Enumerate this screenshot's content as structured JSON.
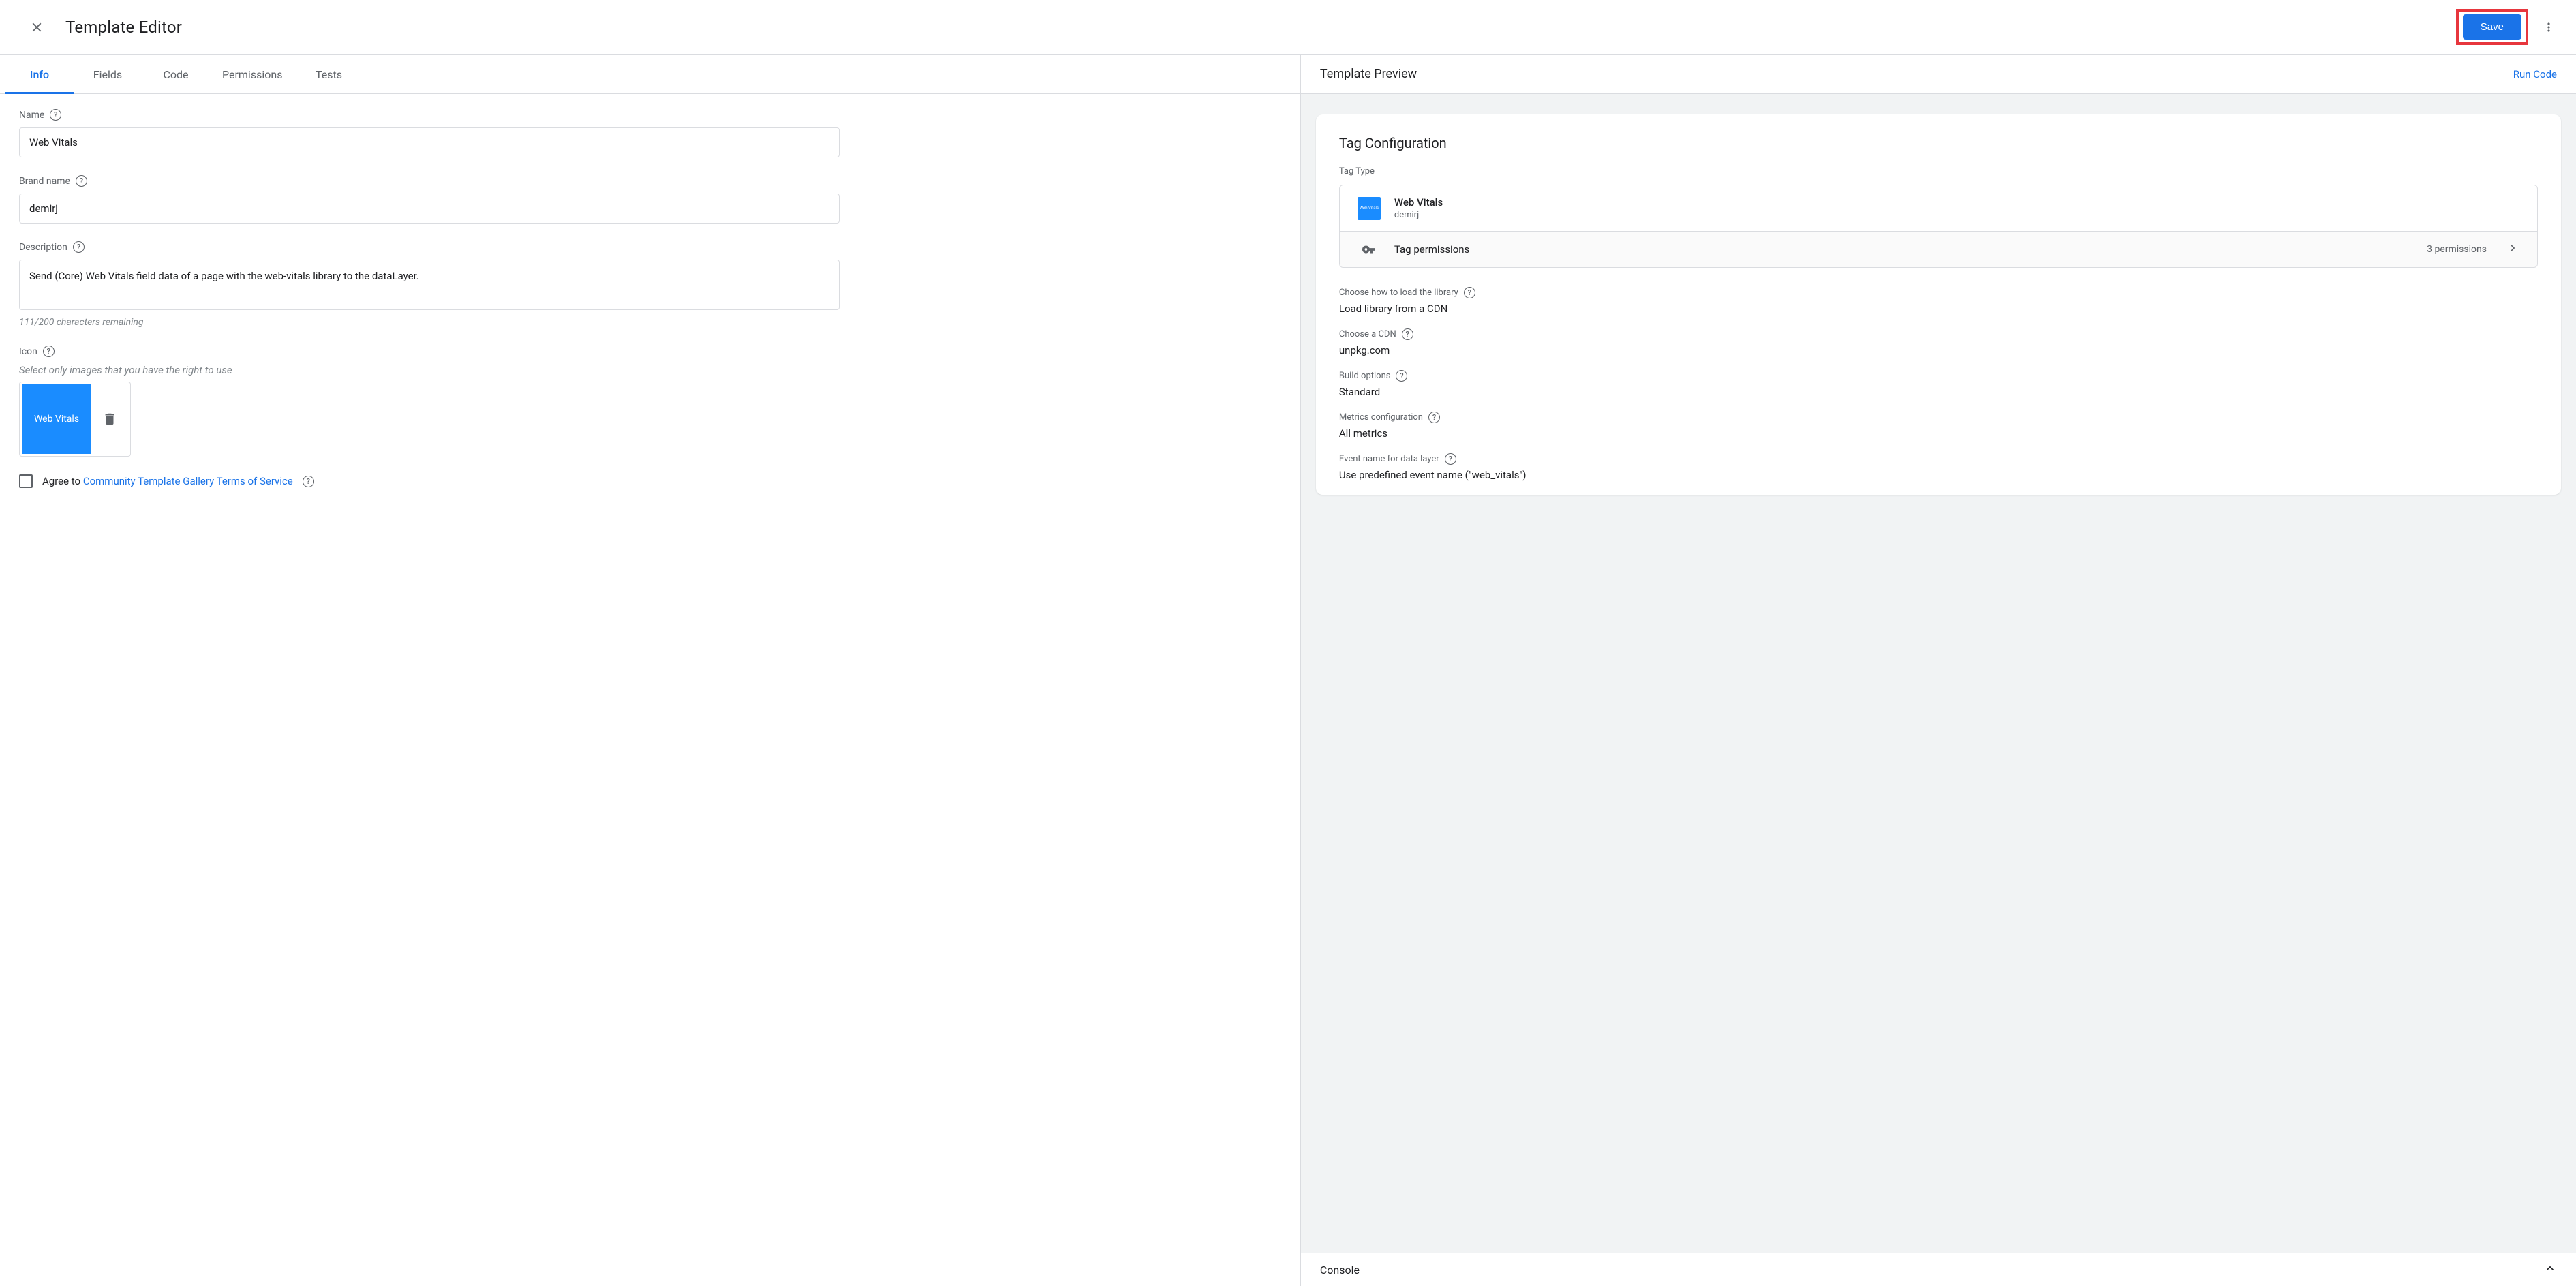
{
  "header": {
    "title": "Template Editor",
    "save_label": "Save"
  },
  "tabs": {
    "t0": "Info",
    "t1": "Fields",
    "t2": "Code",
    "t3": "Permissions",
    "t4": "Tests"
  },
  "form": {
    "name_label": "Name",
    "name_value": "Web Vitals",
    "brand_label": "Brand name",
    "brand_value": "demirj",
    "desc_label": "Description",
    "desc_value": "Send (Core) Web Vitals field data of a page with the web-vitals library to the dataLayer.",
    "char_remaining": "111/200 characters remaining",
    "icon_label": "Icon",
    "icon_hint": "Select only images that you have the right to use",
    "icon_text": "Web Vitals",
    "agree_prefix": "Agree to ",
    "agree_link": "Community Template Gallery Terms of Service"
  },
  "preview": {
    "title": "Template Preview",
    "run_code": "Run Code",
    "card_title": "Tag Configuration",
    "tag_type": "Tag Type",
    "tag_name": "Web Vitals",
    "tag_brand": "demirj",
    "tag_icon_text": "Web Vitals",
    "permissions_label": "Tag permissions",
    "permissions_count": "3 permissions",
    "config": {
      "c0_label": "Choose how to load the library",
      "c0_value": "Load library from a CDN",
      "c1_label": "Choose a CDN",
      "c1_value": "unpkg.com",
      "c2_label": "Build options",
      "c2_value": "Standard",
      "c3_label": "Metrics configuration",
      "c3_value": "All metrics",
      "c4_label": "Event name for data layer",
      "c4_value": "Use predefined event name (\"web_vitals\")"
    }
  },
  "console": {
    "label": "Console"
  }
}
